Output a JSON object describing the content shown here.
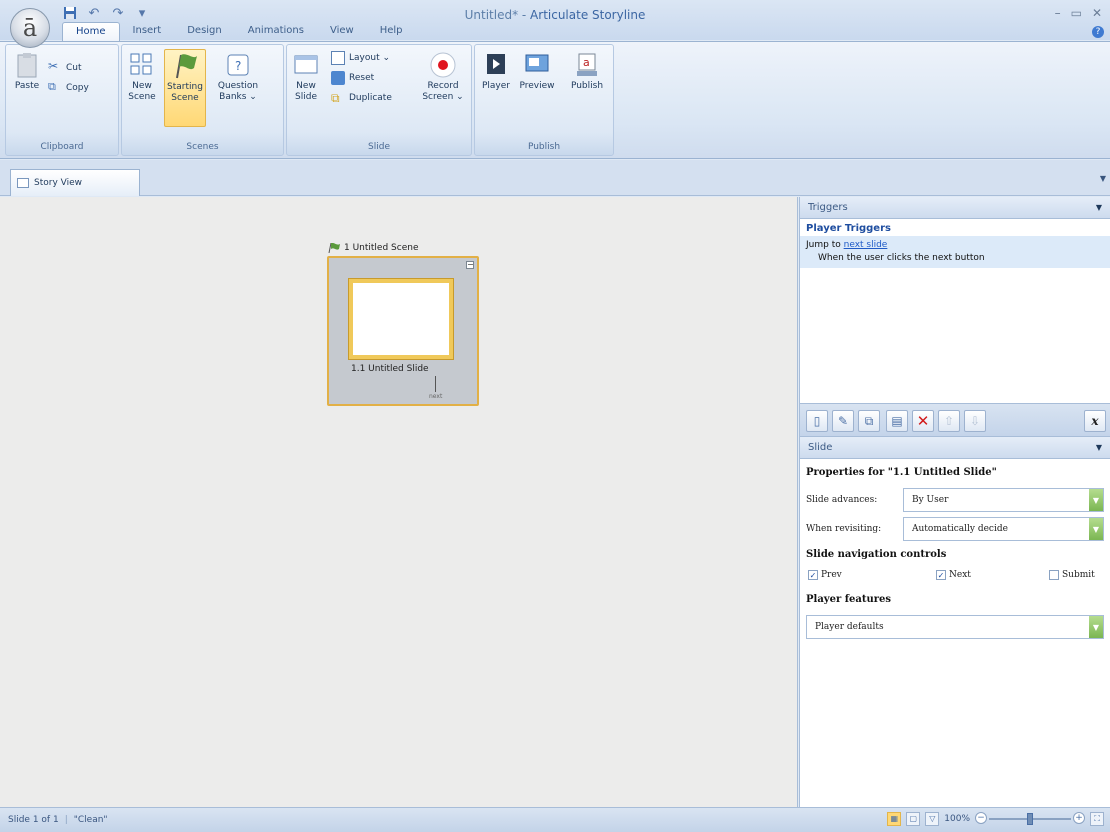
{
  "window": {
    "doc_name": "Untitled*",
    "separator": " - ",
    "app_name": "Articulate Storyline",
    "app_logo": "ā"
  },
  "tabs": [
    {
      "label": "Home",
      "active": true
    },
    {
      "label": "Insert"
    },
    {
      "label": "Design"
    },
    {
      "label": "Animations"
    },
    {
      "label": "View"
    },
    {
      "label": "Help"
    }
  ],
  "ribbon": {
    "clipboard": {
      "paste": "Paste",
      "cut": "Cut",
      "copy": "Copy",
      "group_label": "Clipboard"
    },
    "scenes": {
      "new_scene_1": "New",
      "new_scene_2": "Scene",
      "starting_scene_1": "Starting",
      "starting_scene_2": "Scene",
      "question_banks_1": "Question",
      "question_banks_2": "Banks ⌄",
      "group_label": "Scenes"
    },
    "slide": {
      "new_slide_1": "New",
      "new_slide_2": "Slide",
      "layout": "Layout ⌄",
      "reset": "Reset",
      "duplicate": "Duplicate",
      "record_1": "Record",
      "record_2": "Screen ⌄",
      "group_label": "Slide"
    },
    "publish": {
      "player": "Player",
      "preview": "Preview",
      "publish": "Publish",
      "group_label": "Publish"
    }
  },
  "doc_tab": {
    "label": "Story View"
  },
  "canvas": {
    "scene_label": "1 Untitled Scene",
    "slide_label": "1.1 Untitled Slide",
    "next_label": "next"
  },
  "triggers": {
    "header": "Triggers",
    "section": "Player Triggers",
    "trigger_action": "Jump to ",
    "trigger_target": "next slide",
    "trigger_condition": "When the user clicks the next button"
  },
  "slide_panel": {
    "header": "Slide",
    "properties_title": "Properties for \"1.1 Untitled Slide\"",
    "slide_advances_label": "Slide advances:",
    "slide_advances_value": "By User",
    "when_revisiting_label": "When revisiting:",
    "when_revisiting_value": "Automatically decide",
    "nav_controls_title": "Slide navigation controls",
    "prev": "Prev",
    "next": "Next",
    "submit": "Submit",
    "prev_checked": true,
    "next_checked": true,
    "submit_checked": false,
    "player_features_title": "Player features",
    "player_features_value": "Player defaults"
  },
  "status": {
    "slide_count": "Slide 1 of 1",
    "theme": "\"Clean\"",
    "zoom": "100%"
  },
  "colors": {
    "accent": "#1f4ea0",
    "highlight": "#ffd875",
    "record": "#e0141e",
    "dropdown": "#7bb652"
  }
}
